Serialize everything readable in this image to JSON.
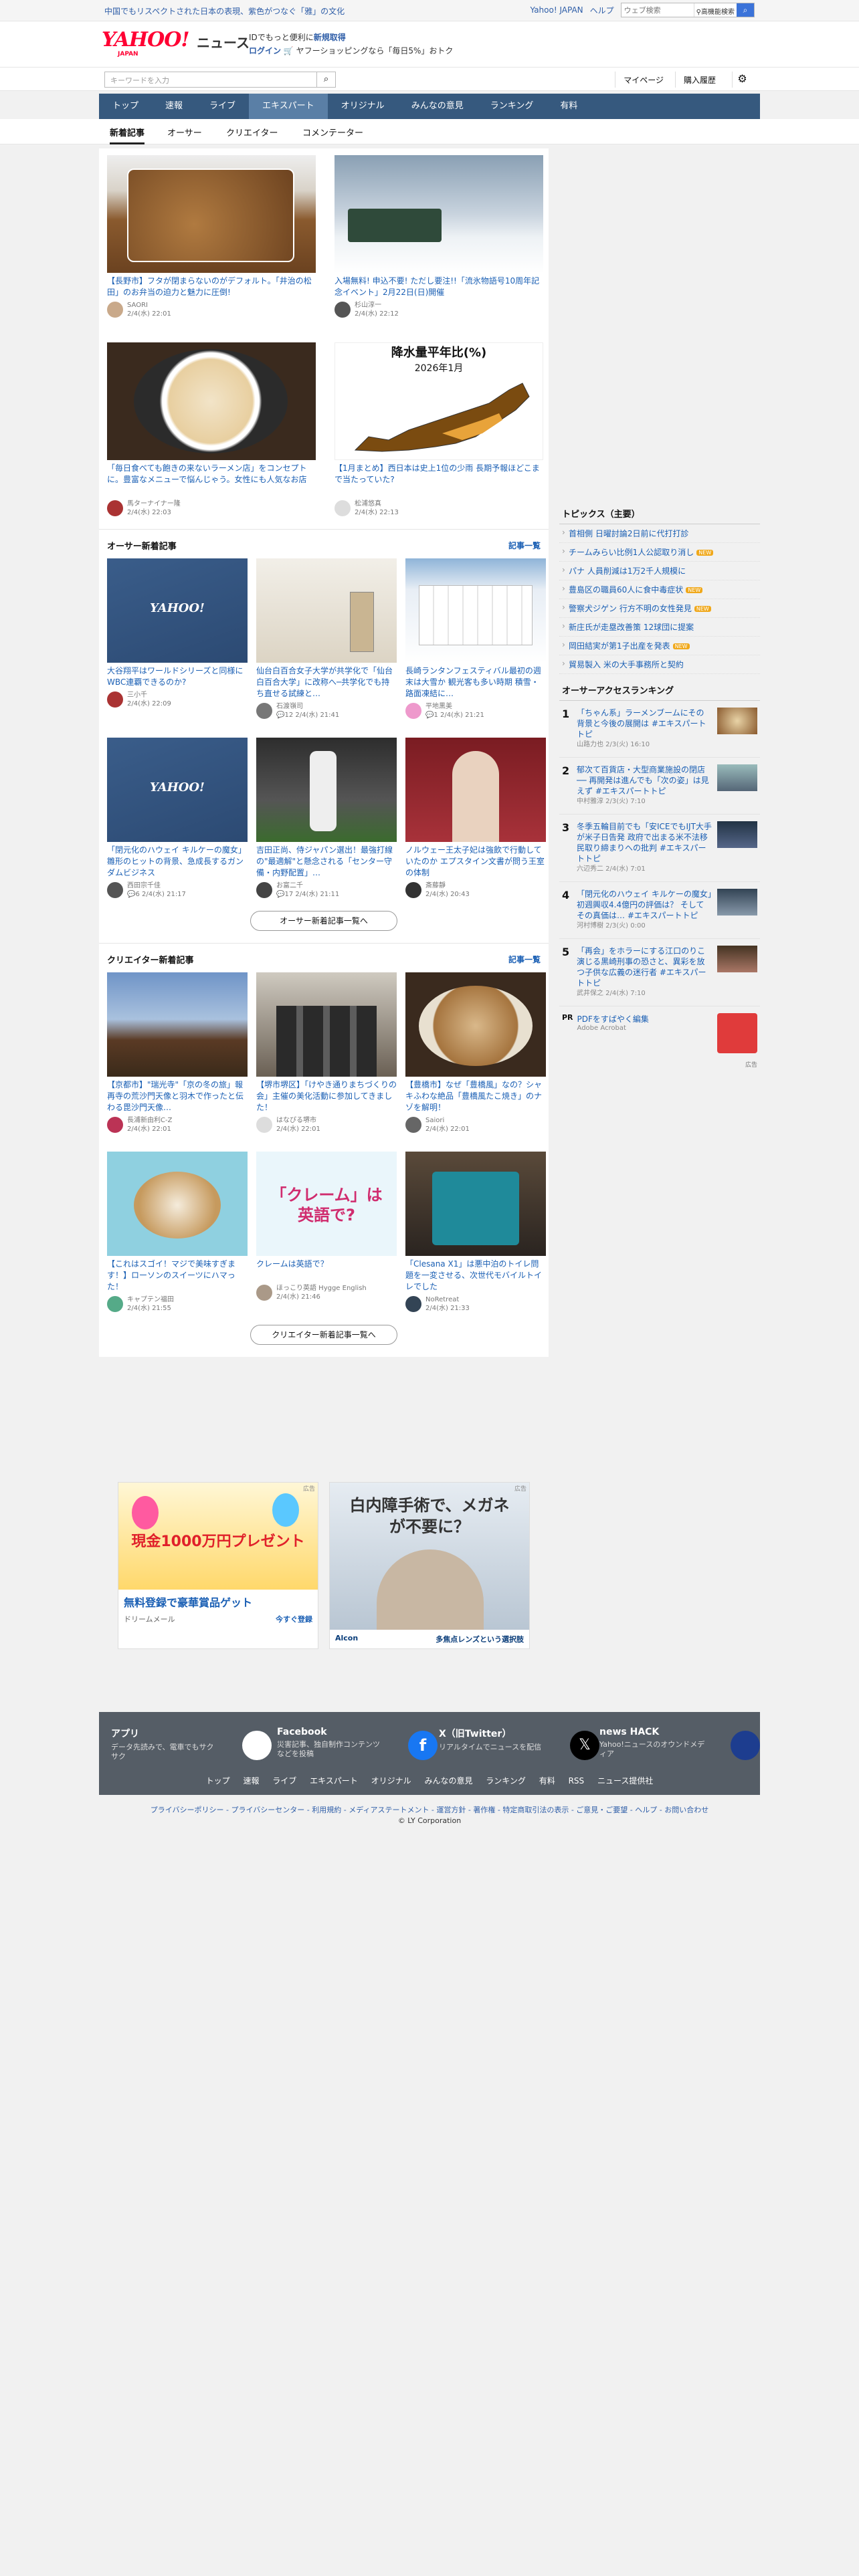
{
  "topbar": {
    "promo": "中国でもリスペクトされた日本の表現、紫色がつなぐ「雅」の文化",
    "links": [
      "Yahoo! JAPAN",
      "ヘルプ"
    ],
    "web_search_placeholder": "ウェブ検索",
    "advanced": "高機能検索"
  },
  "masthead": {
    "logo_text": "YAHOO!",
    "logo_sub": "JAPAN",
    "service": "ニュース",
    "line1_prefix": "IDでもっと便利に",
    "line1_link": "新規取得",
    "login": "ログイン",
    "line2": "ヤフーショッピングなら「毎日5%」おトク"
  },
  "search": {
    "placeholder": "キーワードを入力",
    "mypage": "マイページ",
    "history": "購入履歴"
  },
  "nav": {
    "items": [
      "トップ",
      "速報",
      "ライブ",
      "エキスパート",
      "オリジナル",
      "みんなの意見",
      "ランキング",
      "有料"
    ],
    "current": 3
  },
  "subnav": {
    "items": [
      "新着記事",
      "オーサー",
      "クリエイター",
      "コメンテーター"
    ]
  },
  "expert_articles": [
    {
      "title": "【長野市】フタが閉まらないのがデフォルト。「井治の松田」のお弁当の迫力と魅力に圧倒!",
      "author": "SAORI",
      "date": "2/4(水) 22:01"
    },
    {
      "title": "入場無料! 申込不要! ただし要注!!「流氷物語号10周年記念イベント」2月22日(日)開催",
      "author": "杉山淳一",
      "date": "2/4(水) 22:12"
    },
    {
      "title": "「毎日食べても飽きの来ないラーメン店」をコンセプトに。豊富なメニューで悩んじゃう。女性にも人気なお店",
      "author": "馬ターナイナー隆",
      "date": "2/4(水) 22:03"
    },
    {
      "title": "【1月まとめ】西日本は史上1位の少雨 長期予報ほどこまで当たっていた?",
      "author": "松浦悠真",
      "date": "2/4(水) 22:13"
    }
  ],
  "map_label": {
    "title": "降水量平年比(%)",
    "sub": "2026年1月"
  },
  "author_section": {
    "heading": "オーサー新着記事",
    "more": "記事一覧",
    "button": "オーサー新着記事一覧へ",
    "articles": [
      {
        "title": "大谷翔平はワールドシリーズと同様にWBC連覇できるのか?",
        "author": "三小千",
        "date": "2/4(水) 22:09",
        "comments": ""
      },
      {
        "title": "仙台白百合女子大学が共学化で「仙台白百合大学」に改称へ─共学化でも持ち直せる試練と…",
        "author": "石渡嶺司",
        "date": "2/4(水) 21:41",
        "comments": "12"
      },
      {
        "title": "長崎ランタンフェスティバル最初の週末は大雪か 観光客も多い時期 積雪・路面凍結に…",
        "author": "平地黒美",
        "date": "2/4(水) 21:21",
        "comments": "1"
      },
      {
        "title": "「閉元化のハウェイ キルケーの魔女」雛形のヒットの背景、急成長するガンダムビジネス",
        "author": "西田宗千佳",
        "date": "2/4(水) 21:17",
        "comments": "6"
      },
      {
        "title": "吉田正尚、侍ジャパン選出！最強打線の\"最適解\"と懸念される「センター守備・内野配置」…",
        "author": "お富二千",
        "date": "2/4(水) 21:11",
        "comments": "17"
      },
      {
        "title": "ノルウェー王太子妃は強飲で行動していたのか エプスタイン文書が問う王室の体制",
        "author": "斎藤靜",
        "date": "2/4(水) 20:43",
        "comments": ""
      }
    ]
  },
  "creator_section": {
    "heading": "クリエイター新着記事",
    "more": "記事一覧",
    "button": "クリエイター新着記事一覧へ",
    "articles": [
      {
        "title": "【京都市】\"瑞光寺\"「京の冬の旅」報再寺の荒沙門天像と羽木で作ったと伝わる毘沙門天像…",
        "author": "長浦新由利C-Z",
        "date": "2/4(水) 22:01"
      },
      {
        "title": "【堺市堺区】「けやき通りまちづくりの会」主催の美化活動に参加してきました！",
        "author": "はなぴる堺市",
        "date": "2/4(水) 22:01"
      },
      {
        "title": "【豊橋市】なぜ「豊橋風」なの？シャキふわな絶品「豊橋風たこ焼き」のナゾを解明！",
        "author": "Saiori",
        "date": "2/4(水) 22:01"
      },
      {
        "title": "【これはスゴイ！マジで美味すぎます！】ローソンのスイーツにハマった！",
        "author": "キャプテン福田",
        "date": "2/4(水) 21:55"
      },
      {
        "title": "クレームは英語で？",
        "author": "ほっこり英語 Hygge English",
        "date": "2/4(水) 21:46"
      },
      {
        "title": "「Clesana X1」は悪中泊のトイレ問題を一変させる、次世代モバイルトイレでした",
        "author": "NoRetreat",
        "date": "2/4(水) 21:33"
      }
    ]
  },
  "creator_thumb_text": "「クレーム」は英語で?",
  "topics": {
    "heading": "トピックス（主要）",
    "items": [
      {
        "text": "首相側 日曜討論2日前に代打打診",
        "tag": ""
      },
      {
        "text": "チームみらい比例1人公認取り消し",
        "tag": "NEW"
      },
      {
        "text": "パナ 人員削減は1万2千人規模に",
        "tag": ""
      },
      {
        "text": "豊島区の職員60人に食中毒症状",
        "tag": "NEW"
      },
      {
        "text": "警察犬ジゲン 行方不明の女性発見",
        "tag": "NEW"
      },
      {
        "text": "新庄氏が走塁改善策 12球団に提案",
        "tag": ""
      },
      {
        "text": "岡田結実が第1子出産を発表",
        "tag": "NEW"
      },
      {
        "text": "貿易製入 米の大手事務所と契約",
        "tag": ""
      }
    ]
  },
  "ranking": {
    "heading": "オーサーアクセスランキング",
    "items": [
      {
        "rank": "1",
        "text": "「ちゃん系」ラーメンブームにその背景と今後の展開は #エキスパートトピ",
        "meta": "山路力也 2/3(火) 16:10"
      },
      {
        "rank": "2",
        "text": "郁次て百貨店・大型商業施設の閉店 ── 再開発は進んでも「次の姿」は見えず #エキスパートトピ",
        "meta": "中村雅淳 2/3(火) 7:10"
      },
      {
        "rank": "3",
        "text": "冬季五輪目前でも「安ICEでもIJT大手が米子日告発 政府で出まる米不法移民取り締まりへの批判 #エキスパートトピ",
        "meta": "六辺秀二 2/4(水) 7:01"
      },
      {
        "rank": "4",
        "text": "「閉元化のハウェイ キルケーの魔女」初週興収4.4億円の評価は？ そしてその真価は… #エキスパートトピ",
        "meta": "河村博樹 2/3(火) 0:00"
      },
      {
        "rank": "5",
        "text": "「再会」をホラーにする江口のりこ演じる黒崎刑事の恐さと、異彩を放つ子供な広義の迷行者 #エキスパートトピ",
        "meta": "武井保之 2/4(水) 7:10"
      }
    ]
  },
  "pr": {
    "label": "PR",
    "title": "PDFをすばやく編集",
    "sponsor": "Adobe Acrobat",
    "ad": "広告"
  },
  "ads": [
    {
      "headline": "現金1000万円プレゼント",
      "title": "無料登録で豪華賞品ゲット",
      "sponsor": "ドリームメール",
      "cta": "今すぐ登録",
      "label": "広告"
    },
    {
      "headline": "白内障手術で、メガネが不要に？",
      "sponsor": "Alcon",
      "cta": "多焦点レンズという選択肢",
      "label": "広告"
    }
  ],
  "footer": {
    "cols": [
      {
        "title": "アプリ",
        "desc": "データ先読みで、電車でもサクサク"
      },
      {
        "title": "Facebook",
        "desc": "災害記事、独自制作コンテンツなどを投稿"
      },
      {
        "title": "X（旧Twitter）",
        "desc": "リアルタイムでニュースを配信"
      },
      {
        "title": "news HACK",
        "desc": "Yahoo!ニュースのオウンドメディア"
      }
    ],
    "links": [
      "トップ",
      "速報",
      "ライブ",
      "エキスパート",
      "オリジナル",
      "みんなの意見",
      "ランキング",
      "有料",
      "RSS",
      "ニュース提供社"
    ],
    "legal": "プライバシーポリシー - プライバシーセンター - 利用規約 - メディアステートメント - 運営方針 - 著作権 - 特定商取引法の表示 - ご意見・ご要望 - ヘルプ - お問い合わせ",
    "copyright": "© LY Corporation"
  }
}
